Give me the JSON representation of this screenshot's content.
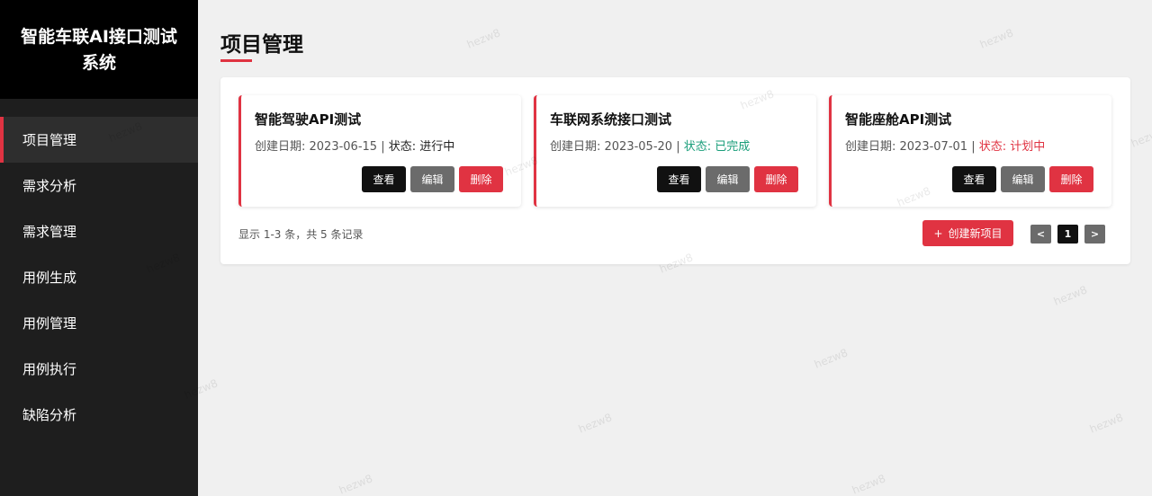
{
  "app": {
    "title": "智能车联AI接口测试系统"
  },
  "sidebar": {
    "items": [
      {
        "label": "项目管理",
        "active": true
      },
      {
        "label": "需求分析",
        "active": false
      },
      {
        "label": "需求管理",
        "active": false
      },
      {
        "label": "用例生成",
        "active": false
      },
      {
        "label": "用例管理",
        "active": false
      },
      {
        "label": "用例执行",
        "active": false
      },
      {
        "label": "缺陷分析",
        "active": false
      }
    ]
  },
  "main": {
    "page_title": "项目管理",
    "projects": [
      {
        "name": "智能驾驶API测试",
        "date_label": "创建日期: 2023-06-15 | ",
        "status_label": "状态: ",
        "status": "进行中"
      },
      {
        "name": "车联网系统接口测试",
        "date_label": "创建日期: 2023-05-20 | ",
        "status_label": "状态: ",
        "status": "已完成"
      },
      {
        "name": "智能座舱API测试",
        "date_label": "创建日期: 2023-07-01 | ",
        "status_label": "状态: ",
        "status": "计划中"
      }
    ],
    "buttons": {
      "view": "查看",
      "edit": "编辑",
      "delete": "删除"
    },
    "records_text": "显示 1-3 条，共 5 条记录",
    "create_button": {
      "icon": "+",
      "label": "创建新项目"
    },
    "pager": {
      "prev": "<",
      "current": "1",
      "next": ">"
    }
  },
  "watermark": "hezw8",
  "colors": {
    "accent": "#e03342",
    "done": "#1a9e7a",
    "sidebar_bg": "#1e1e1e"
  }
}
